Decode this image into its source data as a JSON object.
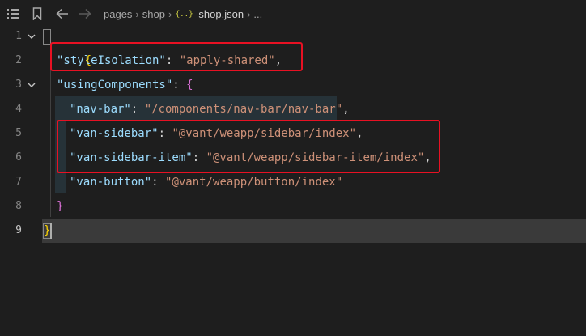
{
  "breadcrumb": {
    "items": [
      "pages",
      "shop"
    ],
    "file_icon": "{..}",
    "file": "shop.json",
    "ellipsis": "..."
  },
  "toolbar_icons": {
    "list": "list-icon",
    "bookmark": "bookmark-icon",
    "back": "arrow-left-icon",
    "forward": "arrow-right-icon"
  },
  "current_line": 9,
  "lines": [
    {
      "num": "1",
      "tokens": [
        {
          "t": "{"
        }
      ]
    },
    {
      "num": "2",
      "tokens": [
        {
          "t": "\"styleIsolation\""
        },
        {
          "t": ": "
        },
        {
          "t": "\"apply-shared\""
        },
        {
          "t": ","
        }
      ]
    },
    {
      "num": "3",
      "tokens": [
        {
          "t": "\"usingComponents\""
        },
        {
          "t": ": "
        },
        {
          "t": "{"
        }
      ]
    },
    {
      "num": "4",
      "tokens": [
        {
          "t": "\"nav-bar\""
        },
        {
          "t": ": "
        },
        {
          "t": "\"/components/nav-bar/nav-bar\""
        },
        {
          "t": ","
        }
      ]
    },
    {
      "num": "5",
      "tokens": [
        {
          "t": "\"van-sidebar\""
        },
        {
          "t": ": "
        },
        {
          "t": "\"@vant/weapp/sidebar/index\""
        },
        {
          "t": ","
        }
      ]
    },
    {
      "num": "6",
      "tokens": [
        {
          "t": "\"van-sidebar-item\""
        },
        {
          "t": ": "
        },
        {
          "t": "\"@vant/weapp/sidebar-item/index\""
        },
        {
          "t": ","
        }
      ]
    },
    {
      "num": "7",
      "tokens": [
        {
          "t": "\"van-button\""
        },
        {
          "t": ": "
        },
        {
          "t": "\"@vant/weapp/button/index\""
        }
      ]
    },
    {
      "num": "8",
      "tokens": [
        {
          "t": "}"
        }
      ]
    },
    {
      "num": "9",
      "tokens": [
        {
          "t": "}"
        }
      ]
    }
  ],
  "colors": {
    "background": "#1e1e1e",
    "key": "#9cdcfe",
    "string": "#ce9178",
    "punctuation": "#d4d4d4",
    "brace_level1": "#ffd700",
    "brace_level2": "#da70d6",
    "highlight_box": "#e81123",
    "current_line_bg": "#3a3a3a"
  }
}
